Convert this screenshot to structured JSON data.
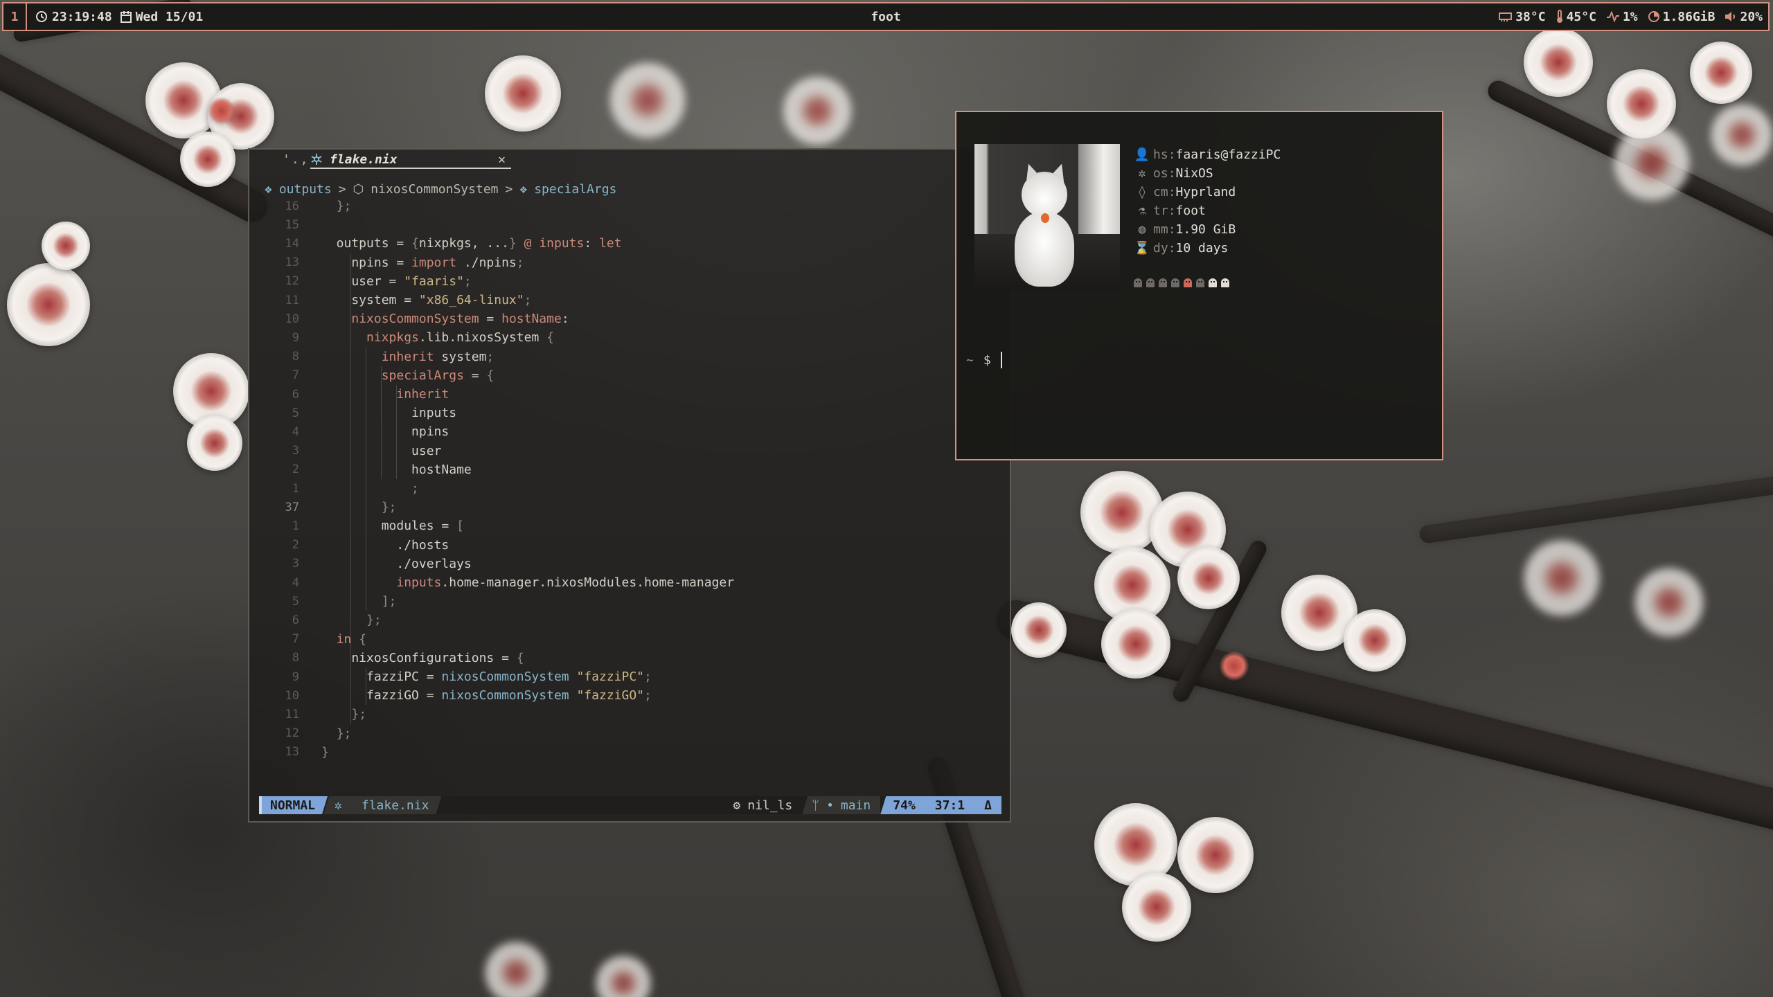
{
  "topbar": {
    "workspace": "1",
    "clock": "23:19:48",
    "date": "Wed 15/01",
    "window_title": "foot",
    "gpu_temp": "38°C",
    "cpu_temp": "45°C",
    "cpu_usage": "1%",
    "memory": "1.86GiB",
    "volume": "20%",
    "icons": [
      "clock-icon",
      "calendar-icon",
      "gpu-icon",
      "thermometer-icon",
      "pulse-icon",
      "memory-icon",
      "volume-icon"
    ]
  },
  "editor": {
    "tabs": {
      "inactive": "'.,",
      "active_file": "flake.nix",
      "close": "✕"
    },
    "breadcrumb": [
      "outputs",
      "nixosCommonSystem",
      "specialArgs"
    ],
    "lines": [
      {
        "n": "16",
        "t": "  };"
      },
      {
        "n": "15",
        "t": ""
      },
      {
        "n": "14",
        "t": "  outputs = {nixpkgs, ...} @ inputs: let"
      },
      {
        "n": "13",
        "t": "    npins = import ./npins;"
      },
      {
        "n": "12",
        "t": "    user = \"faaris\";"
      },
      {
        "n": "11",
        "t": "    system = \"x86_64-linux\";"
      },
      {
        "n": "10",
        "t": "    nixosCommonSystem = hostName:"
      },
      {
        "n": "9",
        "t": "      nixpkgs.lib.nixosSystem {"
      },
      {
        "n": "8",
        "t": "        inherit system;"
      },
      {
        "n": "7",
        "t": "        specialArgs = {"
      },
      {
        "n": "6",
        "t": "          inherit"
      },
      {
        "n": "5",
        "t": "            inputs"
      },
      {
        "n": "4",
        "t": "            npins"
      },
      {
        "n": "3",
        "t": "            user"
      },
      {
        "n": "2",
        "t": "            hostName"
      },
      {
        "n": "1",
        "t": "            ;"
      },
      {
        "n": "37",
        "t": "        };"
      },
      {
        "n": "1",
        "t": "        modules = ["
      },
      {
        "n": "2",
        "t": "          ./hosts"
      },
      {
        "n": "3",
        "t": "          ./overlays"
      },
      {
        "n": "4",
        "t": "          inputs.home-manager.nixosModules.home-manager"
      },
      {
        "n": "5",
        "t": "        ];"
      },
      {
        "n": "6",
        "t": "      };"
      },
      {
        "n": "7",
        "t": "  in {"
      },
      {
        "n": "8",
        "t": "    nixosConfigurations = {"
      },
      {
        "n": "9",
        "t": "      fazziPC = nixosCommonSystem \"fazziPC\";"
      },
      {
        "n": "10",
        "t": "      fazziGO = nixosCommonSystem \"fazziGO\";"
      },
      {
        "n": "11",
        "t": "    };"
      },
      {
        "n": "12",
        "t": "  };"
      },
      {
        "n": "13",
        "t": "}"
      }
    ],
    "current_line_number": "37",
    "statusline": {
      "mode": "NORMAL",
      "file": "flake.nix",
      "lsp": "nil_ls",
      "branch": "main",
      "percent": "74%",
      "position": "37:1",
      "end_marker": "Δ"
    }
  },
  "terminal": {
    "info": [
      {
        "icon": "user-icon",
        "key": "hs",
        "value": "faaris@fazziPC"
      },
      {
        "icon": "nixos-icon",
        "key": "os",
        "value": "NixOS"
      },
      {
        "icon": "droplet-icon",
        "key": "cm",
        "value": "Hyprland"
      },
      {
        "icon": "flask-icon",
        "key": "tr",
        "value": "foot"
      },
      {
        "icon": "memory-icon",
        "key": "mm",
        "value": "1.90 GiB"
      },
      {
        "icon": "hourglass-icon",
        "key": "dy",
        "value": "10 days"
      }
    ],
    "ghost_colors": [
      "#6e6a66",
      "#6e6a66",
      "#6e6a66",
      "#6e6a66",
      "#cc6a5a",
      "#6e6a66",
      "#e2ddd6",
      "#e2ddd6"
    ],
    "prompt_dir": "~",
    "prompt_symbol": "$"
  },
  "colors": {
    "accent": "#d39180",
    "blue": "#7ea4d8",
    "bar_bg": "#1a1a18"
  }
}
